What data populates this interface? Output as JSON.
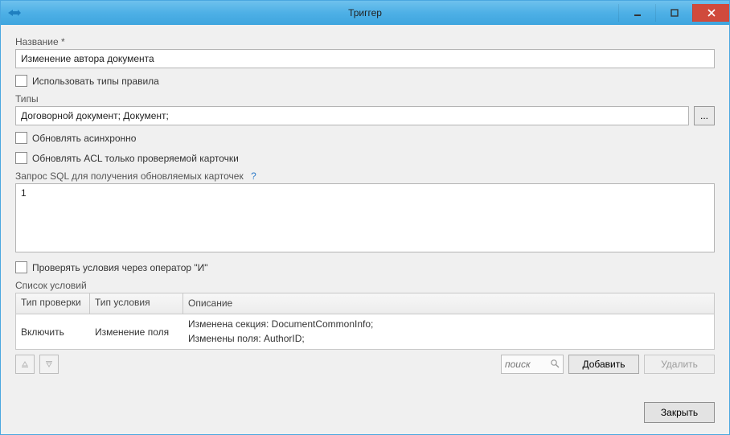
{
  "window": {
    "title": "Триггер"
  },
  "labels": {
    "name": "Название",
    "types": "Типы",
    "query": "Запрос SQL для получения обновляемых карточек",
    "conditions_list": "Список условий"
  },
  "fields": {
    "name_value": "Изменение автора документа",
    "types_value": "Договорной документ; Документ;",
    "query_value": "1"
  },
  "checkboxes": {
    "use_rule_types": "Использовать типы правила",
    "update_async": "Обновлять асинхронно",
    "update_acl_only_checked": "Обновлять ACL только проверяемой карточки",
    "check_conditions_and": "Проверять условия через оператор \"И\""
  },
  "table": {
    "headers": {
      "check_type": "Тип проверки",
      "condition_type": "Тип условия",
      "description": "Описание"
    },
    "rows": [
      {
        "check_type": "Включить",
        "condition_type": "Изменение поля",
        "description_line1": "Изменена секция: DocumentCommonInfo;",
        "description_line2": "Изменены поля: AuthorID;"
      }
    ]
  },
  "controls": {
    "search_placeholder": "поиск",
    "add": "Добавить",
    "delete": "Удалить",
    "close": "Закрыть",
    "ellipsis": "..."
  }
}
